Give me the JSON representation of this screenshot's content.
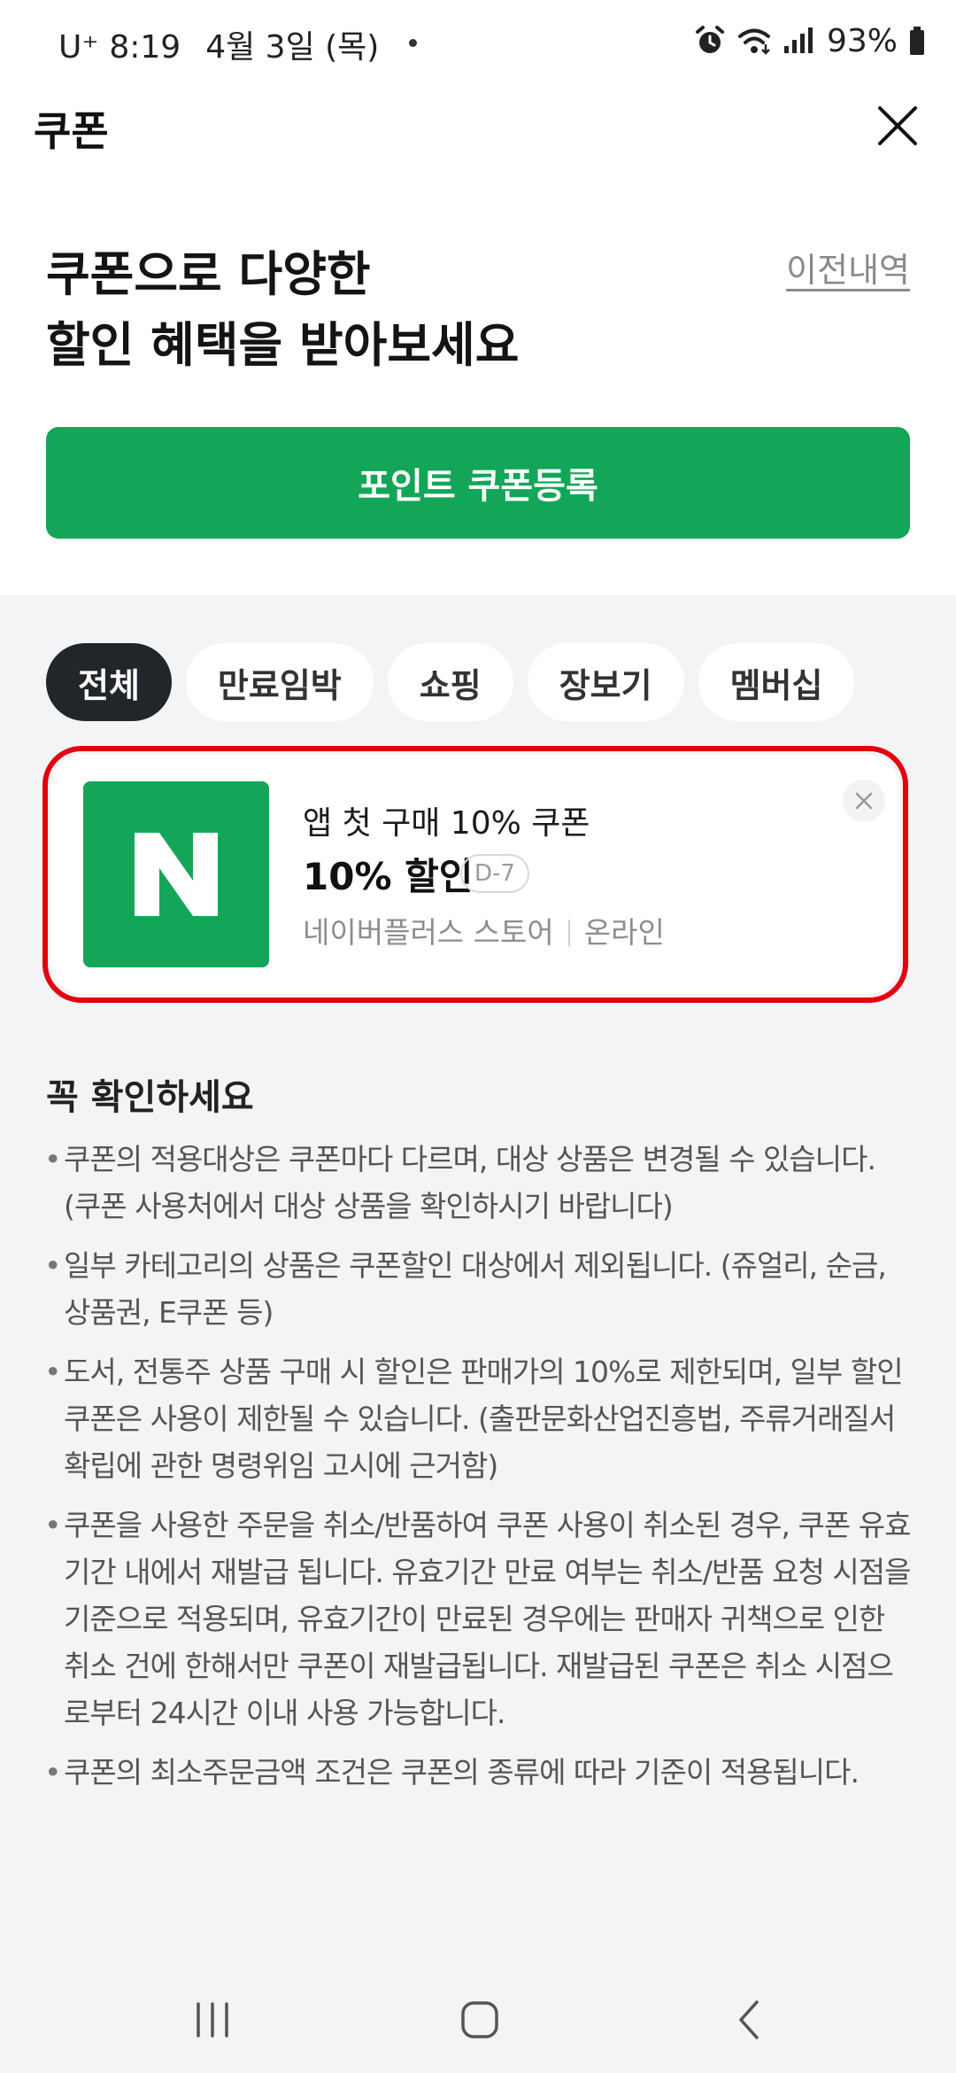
{
  "status_bar": {
    "carrier": "U⁺",
    "time": "8:19",
    "date": "4월 3일 (목)",
    "battery": "93%"
  },
  "header": {
    "title": "쿠폰"
  },
  "hero": {
    "title_line1": "쿠폰으로 다양한",
    "title_line2": "할인 혜택을 받아보세요",
    "history_link": "이전내역"
  },
  "register_button": "포인트 쿠폰등록",
  "filters": [
    "전체",
    "만료임박",
    "쇼핑",
    "장보기",
    "멤버십"
  ],
  "active_filter": "전체",
  "coupon": {
    "logo_letter": "N",
    "name": "앱 첫 구매 10% 쿠폰",
    "discount": "10% 할인",
    "dday": "D-7",
    "store": "네이버플러스 스토어",
    "channel": "온라인"
  },
  "notice": {
    "title": "꼭 확인하세요",
    "items": [
      "쿠폰의 적용대상은 쿠폰마다 다르며, 대상 상품은 변경될 수 있습니다. (쿠폰 사용처에서 대상 상품을 확인하시기 바랍니다)",
      "일부 카테고리의 상품은 쿠폰할인 대상에서 제외됩니다. (쥬얼리, 순금, 상품권, E쿠폰 등)",
      "도서, 전통주 상품 구매 시 할인은 판매가의 10%로 제한되며, 일부 할인 쿠폰은 사용이 제한될 수 있습니다. (출판문화산업진흥법, 주류거래질서 확립에 관한 명령위임 고시에 근거함)",
      "쿠폰을 사용한 주문을 취소/반품하여 쿠폰 사용이 취소된 경우, 쿠폰 유효기간 내에서 재발급 됩니다. 유효기간 만료 여부는 취소/반품 요청 시점을 기준으로 적용되며, 유효기간이 만료된 경우에는 판매자 귀책으로 인한 취소 건에 한해서만 쿠폰이 재발급됩니다. 재발급된 쿠폰은 취소 시점으로부터 24시간 이내 사용 가능합니다.",
      "쿠폰의 최소주문금액 조건은 쿠폰의 종류에 따라 기준이 적용됩니다."
    ]
  },
  "colors": {
    "brand_green": "#13a658",
    "highlight_red": "#e3000f",
    "chip_active": "#22252a"
  },
  "icons": [
    "alarm-icon",
    "wifi-icon",
    "signal-icon",
    "battery-icon",
    "close-icon",
    "recent-apps-icon",
    "home-icon",
    "back-icon"
  ]
}
